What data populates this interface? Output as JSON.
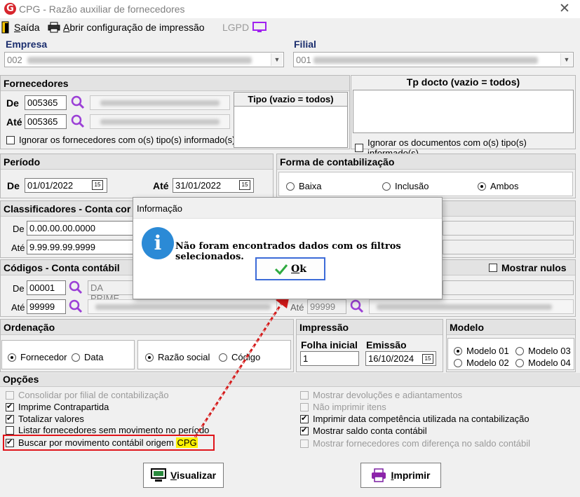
{
  "window": {
    "title": "CPG - Razão auxiliar de fornecedores",
    "logo_letter": "G"
  },
  "toolbar": {
    "exit_label": "Saída",
    "print_config_label": "Abrir configuração de impressão",
    "lgpd_label": "LGPD"
  },
  "empresa": {
    "label": "Empresa",
    "value": "002"
  },
  "filial": {
    "label": "Filial",
    "value": "001"
  },
  "fornecedores": {
    "title": "Fornecedores",
    "de_label": "De",
    "de_value": "005365",
    "ate_label": "Até",
    "ate_value": "005365",
    "tipo_title": "Tipo (vazio = todos)",
    "ignore_label": "Ignorar os fornecedores com o(s) tipo(s) informado(s)"
  },
  "tp_docto": {
    "title": "Tp docto (vazio = todos)",
    "ignore_label": "Ignorar os documentos com o(s) tipo(s) informado(s)"
  },
  "periodo": {
    "title": "Período",
    "de_label": "De",
    "de_value": "01/01/2022",
    "ate_label": "Até",
    "ate_value": "31/01/2022",
    "cal_text": "15"
  },
  "forma": {
    "title": "Forma de contabilização",
    "options": [
      "Baixa",
      "Inclusão",
      "Ambos"
    ],
    "selected": "Ambos"
  },
  "classificadores": {
    "title": "Classificadores - Conta cor",
    "de_label": "De",
    "de_value": "0.00.00.00.0000",
    "ate_label": "Até",
    "ate_value": "9.99.99.99.9999"
  },
  "codigos": {
    "title": "Códigos - Conta contábil",
    "de_label": "De",
    "de_value": "00001",
    "de_desc": "DA PRIME",
    "ate_label": "Até",
    "ate_value": "99999",
    "ate2_label": "Até",
    "ate2_value": "99999",
    "mostrar_nulos": "Mostrar nulos"
  },
  "ordenacao": {
    "title": "Ordenação",
    "group1": [
      "Fornecedor",
      "Data"
    ],
    "group1_selected": "Fornecedor",
    "group2": [
      "Razão social",
      "Código"
    ],
    "group2_selected": "Razão social"
  },
  "impressao": {
    "title": "Impressão",
    "folha_label": "Folha inicial",
    "folha_value": "1",
    "emissao_label": "Emissão",
    "emissao_value": "16/10/2024"
  },
  "modelo": {
    "title": "Modelo",
    "options": [
      "Modelo 01",
      "Modelo 03",
      "Modelo 02",
      "Modelo 04"
    ],
    "selected": "Modelo 01"
  },
  "opcoes": {
    "title": "Opções",
    "left": [
      {
        "label": "Consolidar por filial de contabilização",
        "checked": false,
        "disabled": true
      },
      {
        "label": "Imprime Contrapartida",
        "checked": true,
        "disabled": false
      },
      {
        "label": "Totalizar valores",
        "checked": true,
        "disabled": false
      },
      {
        "label": "Listar fornecedores sem movimento no período",
        "checked": false,
        "disabled": false
      }
    ],
    "highlight_prefix": "Buscar por movimento contábil origem ",
    "highlight_word": "CPG",
    "right": [
      {
        "label": "Mostrar devoluções e adiantamentos",
        "checked": false,
        "disabled": true
      },
      {
        "label": "Não imprimir itens",
        "checked": false,
        "disabled": true
      },
      {
        "label": "Imprimir data competência utilizada na contabilização",
        "checked": true,
        "disabled": false
      },
      {
        "label": "Mostrar saldo conta contábil",
        "checked": true,
        "disabled": false
      },
      {
        "label": "Mostrar fornecedores com diferença no saldo contábil",
        "checked": false,
        "disabled": true
      }
    ]
  },
  "buttons": {
    "visualizar": "Visualizar",
    "imprimir": "Imprimir"
  },
  "dialog": {
    "title": "Informação",
    "message": "Não foram encontrados dados com os filtros selecionados.",
    "ok_label": "Ok"
  },
  "colors": {
    "accent_red": "#e0141a",
    "dialog_blue": "#2b8ad6",
    "highlight_yellow": "#fff200",
    "header_blue": "#1b2e6e"
  }
}
